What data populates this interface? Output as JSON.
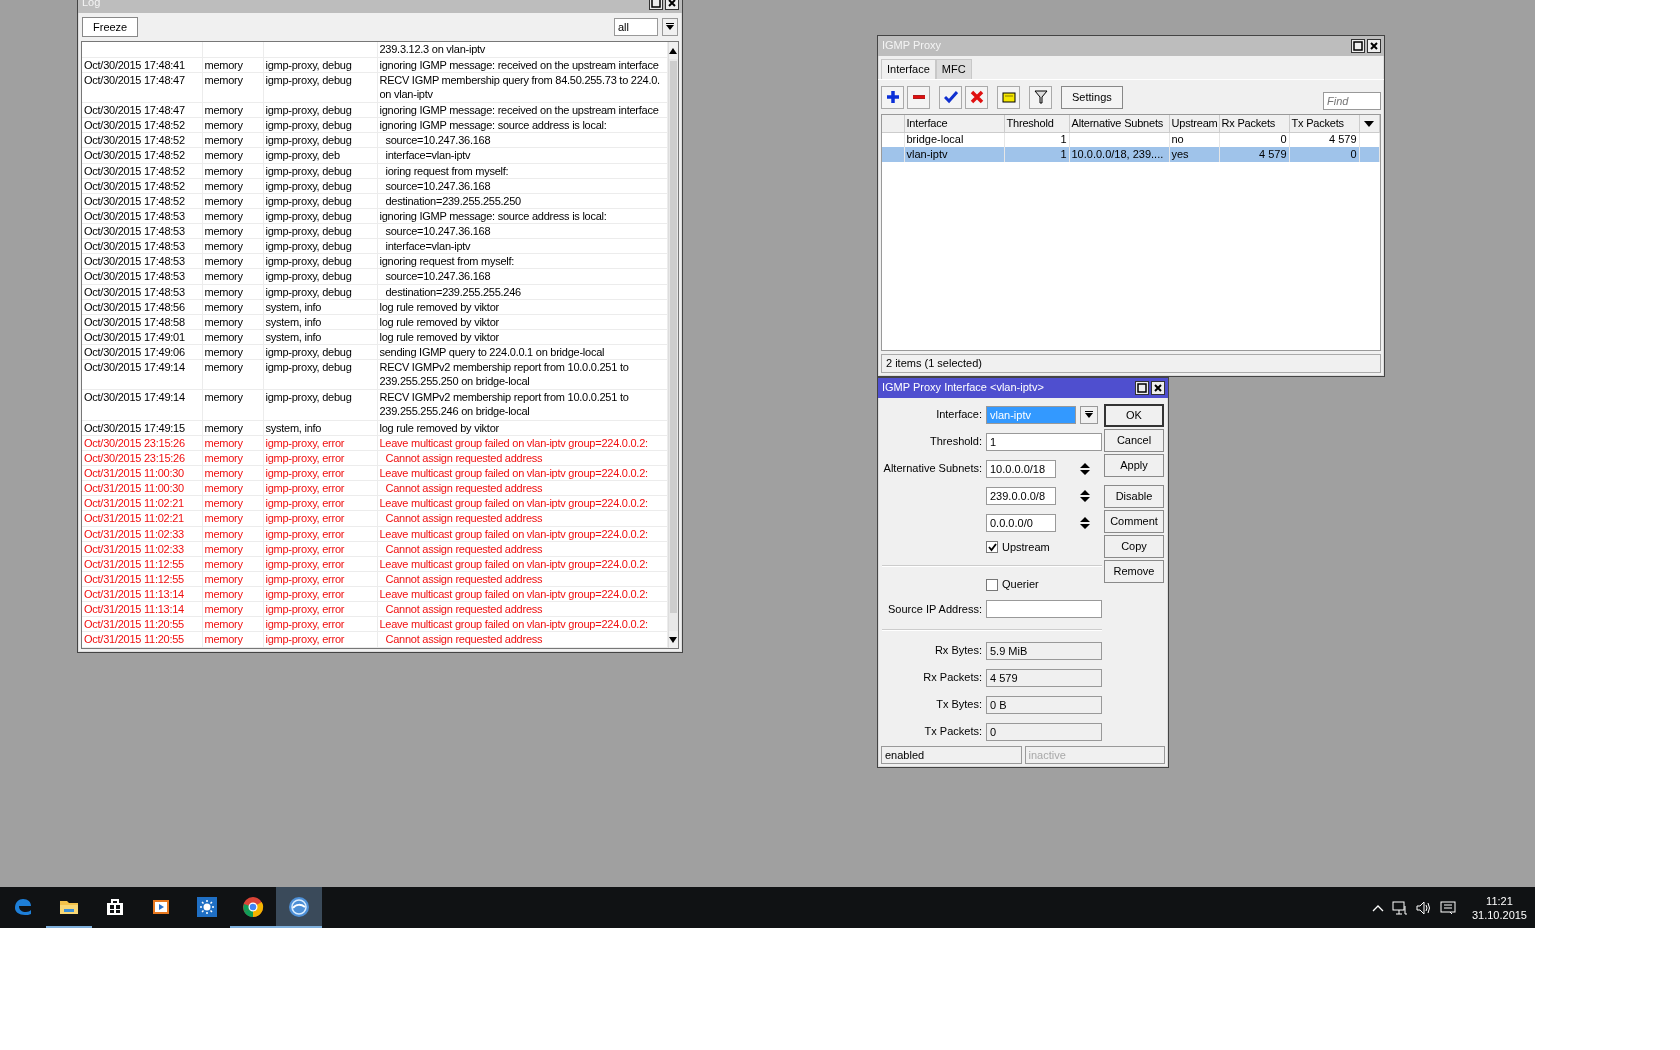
{
  "log_window": {
    "title": "Log",
    "freeze_button": "Freeze",
    "filter": "all",
    "rows": [
      {
        "kind": "debug",
        "indented": false,
        "message_lines": [
          "239.3.12.3 on vlan-iptv"
        ]
      },
      {
        "kind": "debug",
        "indented": false,
        "time": "Oct/30/2015 17:48:41",
        "buffer": "memory",
        "topics": "igmp-proxy, debug",
        "message_lines": [
          "ignoring IGMP message: received on the upstream interface"
        ]
      },
      {
        "kind": "debug",
        "indented": false,
        "time": "Oct/30/2015 17:48:47",
        "buffer": "memory",
        "topics": "igmp-proxy, debug",
        "message_lines": [
          "RECV IGMP membership query from 84.50.255.73 to 224.0.",
          "on vlan-iptv"
        ]
      },
      {
        "kind": "debug",
        "indented": false,
        "time": "Oct/30/2015 17:48:47",
        "buffer": "memory",
        "topics": "igmp-proxy, debug",
        "message_lines": [
          "ignoring IGMP message: received on the upstream interface"
        ]
      },
      {
        "kind": "debug",
        "indented": false,
        "time": "Oct/30/2015 17:48:52",
        "buffer": "memory",
        "topics": "igmp-proxy, debug",
        "message_lines": [
          "ignoring IGMP message: source address is local:"
        ]
      },
      {
        "kind": "debug",
        "indented": true,
        "time": "Oct/30/2015 17:48:52",
        "buffer": "memory",
        "topics": "igmp-proxy, debug",
        "message_lines": [
          "source=10.247.36.168"
        ]
      },
      {
        "kind": "debug",
        "indented": true,
        "time": "Oct/30/2015 17:48:52",
        "buffer": "memory",
        "topics": "igmp-proxy, deb",
        "message_lines": [
          "interface=vlan-iptv"
        ]
      },
      {
        "kind": "debug",
        "indented": true,
        "time": "Oct/30/2015 17:48:52",
        "buffer": "memory",
        "topics": "igmp-proxy, debug",
        "message_lines": [
          "ioring request from myself:"
        ]
      },
      {
        "kind": "debug",
        "indented": true,
        "time": "Oct/30/2015 17:48:52",
        "buffer": "memory",
        "topics": "igmp-proxy, debug",
        "message_lines": [
          "source=10.247.36.168"
        ]
      },
      {
        "kind": "debug",
        "indented": true,
        "time": "Oct/30/2015 17:48:52",
        "buffer": "memory",
        "topics": "igmp-proxy, debug",
        "message_lines": [
          "destination=239.255.255.250"
        ]
      },
      {
        "kind": "debug",
        "indented": false,
        "time": "Oct/30/2015 17:48:53",
        "buffer": "memory",
        "topics": "igmp-proxy, debug",
        "message_lines": [
          "ignoring IGMP message: source address is local:"
        ]
      },
      {
        "kind": "debug",
        "indented": true,
        "time": "Oct/30/2015 17:48:53",
        "buffer": "memory",
        "topics": "igmp-proxy, debug",
        "message_lines": [
          "source=10.247.36.168"
        ]
      },
      {
        "kind": "debug",
        "indented": true,
        "time": "Oct/30/2015 17:48:53",
        "buffer": "memory",
        "topics": "igmp-proxy, debug",
        "message_lines": [
          "interface=vlan-iptv"
        ]
      },
      {
        "kind": "debug",
        "indented": false,
        "time": "Oct/30/2015 17:48:53",
        "buffer": "memory",
        "topics": "igmp-proxy, debug",
        "message_lines": [
          "ignoring request from myself:"
        ]
      },
      {
        "kind": "debug",
        "indented": true,
        "time": "Oct/30/2015 17:48:53",
        "buffer": "memory",
        "topics": "igmp-proxy, debug",
        "message_lines": [
          "source=10.247.36.168"
        ]
      },
      {
        "kind": "debug",
        "indented": true,
        "time": "Oct/30/2015 17:48:53",
        "buffer": "memory",
        "topics": "igmp-proxy, debug",
        "message_lines": [
          "destination=239.255.255.246"
        ]
      },
      {
        "kind": "info",
        "indented": false,
        "time": "Oct/30/2015 17:48:56",
        "buffer": "memory",
        "topics": "system, info",
        "message_lines": [
          "log rule removed by viktor"
        ]
      },
      {
        "kind": "info",
        "indented": false,
        "time": "Oct/30/2015 17:48:58",
        "buffer": "memory",
        "topics": "system, info",
        "message_lines": [
          "log rule removed by viktor"
        ]
      },
      {
        "kind": "info",
        "indented": false,
        "time": "Oct/30/2015 17:49:01",
        "buffer": "memory",
        "topics": "system, info",
        "message_lines": [
          "log rule removed by viktor"
        ]
      },
      {
        "kind": "debug",
        "indented": false,
        "time": "Oct/30/2015 17:49:06",
        "buffer": "memory",
        "topics": "igmp-proxy, debug",
        "message_lines": [
          "sending IGMP query to 224.0.0.1 on bridge-local"
        ]
      },
      {
        "kind": "debug",
        "indented": false,
        "time": "Oct/30/2015 17:49:14",
        "buffer": "memory",
        "topics": "igmp-proxy, debug",
        "message_lines": [
          "RECV IGMPv2 membership report from 10.0.0.251 to",
          "239.255.255.250 on bridge-local"
        ]
      },
      {
        "kind": "debug",
        "indented": false,
        "time": "Oct/30/2015 17:49:14",
        "buffer": "memory",
        "topics": "igmp-proxy, debug",
        "message_lines": [
          "RECV IGMPv2 membership report from 10.0.0.251 to",
          "239.255.255.246 on bridge-local"
        ]
      },
      {
        "kind": "info",
        "indented": false,
        "time": "Oct/30/2015 17:49:15",
        "buffer": "memory",
        "topics": "system, info",
        "message_lines": [
          "log rule removed by viktor"
        ]
      },
      {
        "kind": "error",
        "indented": false,
        "time": "Oct/30/2015 23:15:26",
        "buffer": "memory",
        "topics": "igmp-proxy, error",
        "message_lines": [
          "Leave multicast group failed on vlan-iptv group=224.0.0.2:"
        ]
      },
      {
        "kind": "error",
        "indented": true,
        "time": "Oct/30/2015 23:15:26",
        "buffer": "memory",
        "topics": "igmp-proxy, error",
        "message_lines": [
          "Cannot assign requested address"
        ]
      },
      {
        "kind": "error",
        "indented": false,
        "time": "Oct/31/2015 11:00:30",
        "buffer": "memory",
        "topics": "igmp-proxy, error",
        "message_lines": [
          "Leave multicast group failed on vlan-iptv group=224.0.0.2:"
        ]
      },
      {
        "kind": "error",
        "indented": true,
        "time": "Oct/31/2015 11:00:30",
        "buffer": "memory",
        "topics": "igmp-proxy, error",
        "message_lines": [
          "Cannot assign requested address"
        ]
      },
      {
        "kind": "error",
        "indented": false,
        "time": "Oct/31/2015 11:02:21",
        "buffer": "memory",
        "topics": "igmp-proxy, error",
        "message_lines": [
          "Leave multicast group failed on vlan-iptv group=224.0.0.2:"
        ]
      },
      {
        "kind": "error",
        "indented": true,
        "time": "Oct/31/2015 11:02:21",
        "buffer": "memory",
        "topics": "igmp-proxy, error",
        "message_lines": [
          "Cannot assign requested address"
        ]
      },
      {
        "kind": "error",
        "indented": false,
        "time": "Oct/31/2015 11:02:33",
        "buffer": "memory",
        "topics": "igmp-proxy, error",
        "message_lines": [
          "Leave multicast group failed on vlan-iptv group=224.0.0.2:"
        ]
      },
      {
        "kind": "error",
        "indented": true,
        "time": "Oct/31/2015 11:02:33",
        "buffer": "memory",
        "topics": "igmp-proxy, error",
        "message_lines": [
          "Cannot assign requested address"
        ]
      },
      {
        "kind": "error",
        "indented": false,
        "time": "Oct/31/2015 11:12:55",
        "buffer": "memory",
        "topics": "igmp-proxy, error",
        "message_lines": [
          "Leave multicast group failed on vlan-iptv group=224.0.0.2:"
        ]
      },
      {
        "kind": "error",
        "indented": true,
        "time": "Oct/31/2015 11:12:55",
        "buffer": "memory",
        "topics": "igmp-proxy, error",
        "message_lines": [
          "Cannot assign requested address"
        ]
      },
      {
        "kind": "error",
        "indented": false,
        "time": "Oct/31/2015 11:13:14",
        "buffer": "memory",
        "topics": "igmp-proxy, error",
        "message_lines": [
          "Leave multicast group failed on vlan-iptv group=224.0.0.2:"
        ]
      },
      {
        "kind": "error",
        "indented": true,
        "time": "Oct/31/2015 11:13:14",
        "buffer": "memory",
        "topics": "igmp-proxy, error",
        "message_lines": [
          "Cannot assign requested address"
        ]
      },
      {
        "kind": "error",
        "indented": false,
        "time": "Oct/31/2015 11:20:55",
        "buffer": "memory",
        "topics": "igmp-proxy, error",
        "message_lines": [
          "Leave multicast group failed on vlan-iptv group=224.0.0.2:"
        ]
      },
      {
        "kind": "error",
        "indented": true,
        "time": "Oct/31/2015 11:20:55",
        "buffer": "memory",
        "topics": "igmp-proxy, error",
        "message_lines": [
          "Cannot assign requested address"
        ]
      }
    ]
  },
  "proxy_window": {
    "title": "IGMP Proxy",
    "active": false,
    "tabs": [
      {
        "label": "Interface",
        "selected": true
      },
      {
        "label": "MFC",
        "selected": false
      }
    ],
    "toolbar": [
      {
        "kind": "add"
      },
      {
        "kind": "remove"
      },
      {
        "kind": "enable"
      },
      {
        "kind": "disable"
      },
      {
        "kind": "comment"
      },
      {
        "kind": "filter"
      }
    ],
    "settings_button": "Settings",
    "find_placeholder": "Find",
    "columns": [
      "Interface",
      "Threshold",
      "Alternative Subnets",
      "Upstream",
      "Rx Packets",
      "Tx Packets"
    ],
    "rows": [
      {
        "selected": false,
        "cells": [
          "bridge-local",
          "1",
          "",
          "no",
          "0",
          "4 579"
        ]
      },
      {
        "selected": true,
        "cells": [
          "vlan-iptv",
          "1",
          "10.0.0.0/18, 239....",
          "yes",
          "4 579",
          "0"
        ]
      }
    ],
    "status": "2 items (1 selected)"
  },
  "interface_dialog": {
    "title": "IGMP Proxy Interface <vlan-iptv>",
    "active": true,
    "interface_label": "Interface:",
    "interface_value": "vlan-iptv",
    "interface_text_selected": true,
    "threshold_label": "Threshold:",
    "threshold_value": "1",
    "subnets_label": "Alternative Subnets:",
    "subnets": [
      "10.0.0.0/18",
      "239.0.0.0/8",
      "0.0.0.0/0"
    ],
    "upstream": {
      "label": "Upstream",
      "checked": true
    },
    "querier": {
      "label": "Querier",
      "checked": false
    },
    "source_ip_label": "Source IP Address:",
    "stats": [
      {
        "label": "Rx Bytes:",
        "value": "5.9 MiB"
      },
      {
        "label": "Rx Packets:",
        "value": "4 579"
      },
      {
        "label": "Tx Bytes:",
        "value": "0 B"
      },
      {
        "label": "Tx Packets:",
        "value": "0"
      }
    ],
    "buttons": [
      {
        "label": "OK",
        "default": true
      },
      {
        "label": "Cancel",
        "default": false
      },
      {
        "label": "Apply",
        "default": false
      },
      {
        "label": "Disable",
        "default": false
      },
      {
        "label": "Comment",
        "default": false
      },
      {
        "label": "Copy",
        "default": false
      },
      {
        "label": "Remove",
        "default": false
      }
    ],
    "status_bar": [
      {
        "text": "enabled",
        "disabled": false
      },
      {
        "text": "inactive",
        "disabled": true
      }
    ]
  },
  "taskbar": {
    "apps": [
      {
        "kind": "edge",
        "running": false,
        "active": false
      },
      {
        "kind": "explorer",
        "running": true,
        "active": false
      },
      {
        "kind": "store",
        "running": false,
        "active": false
      },
      {
        "kind": "media",
        "running": false,
        "active": false
      },
      {
        "kind": "weather",
        "running": false,
        "active": false
      },
      {
        "kind": "chrome",
        "running": true,
        "active": false
      },
      {
        "kind": "winbox",
        "running": true,
        "active": true
      }
    ],
    "time": "11:21",
    "date": "31.10.2015"
  }
}
